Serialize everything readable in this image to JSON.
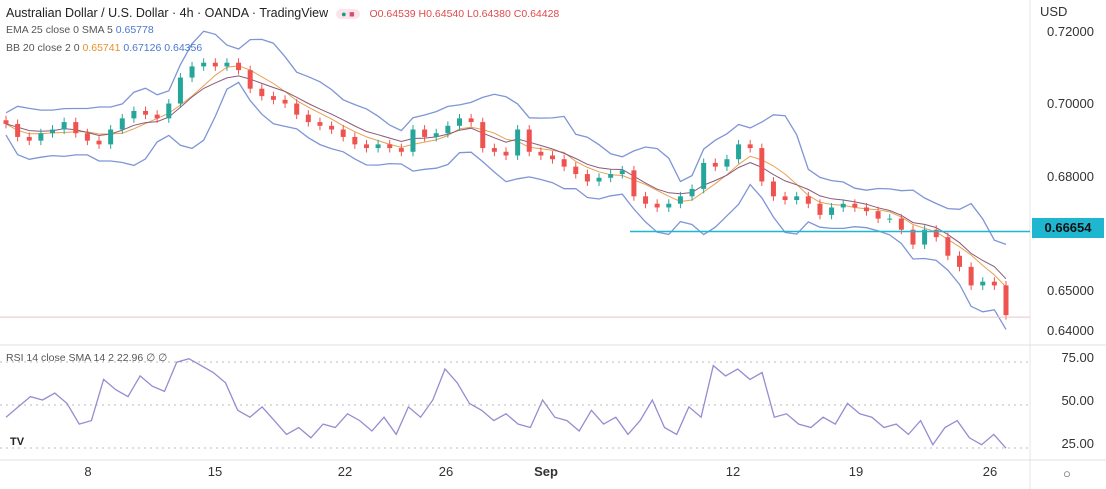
{
  "header": {
    "title": "Australian Dollar / U.S. Dollar · 4h · OANDA · TradingView",
    "open": "O0.64539",
    "high": "H0.64540",
    "low": "L0.64380",
    "close": "C0.64428",
    "ema_label": "EMA 25 close 0 SMA 5",
    "ema_value": "0.65778",
    "bb_label": "BB 20 close 2 0",
    "bb_basis": "0.65741",
    "bb_upper": "0.67126",
    "bb_lower": "0.64356",
    "rsi_label": "RSI 14 close SMA 14 2",
    "rsi_value": "22.96",
    "rsi_extra": "∅ ∅"
  },
  "axis": {
    "currency": "USD",
    "price_ticks": [
      "0.72000",
      "0.70000",
      "0.68000",
      "0.65000",
      "0.64000"
    ],
    "rsi_ticks": [
      "75.00",
      "50.00",
      "25.00"
    ],
    "time_ticks": [
      "8",
      "15",
      "22",
      "26",
      "Sep",
      "12",
      "19",
      "26"
    ]
  },
  "level": {
    "value": "0.66654",
    "color": "#1fb6d0"
  },
  "logo": "TV",
  "chart_data": {
    "type": "candlestick",
    "title": "Australian Dollar / U.S. Dollar 4h",
    "ylim": [
      0.64,
      0.72
    ],
    "closes": [
      0.6955,
      0.692,
      0.691,
      0.693,
      0.694,
      0.696,
      0.693,
      0.691,
      0.69,
      0.694,
      0.697,
      0.699,
      0.698,
      0.697,
      0.701,
      0.708,
      0.711,
      0.712,
      0.711,
      0.712,
      0.71,
      0.705,
      0.703,
      0.702,
      0.701,
      0.698,
      0.696,
      0.695,
      0.694,
      0.692,
      0.69,
      0.689,
      0.69,
      0.689,
      0.688,
      0.694,
      0.692,
      0.693,
      0.695,
      0.697,
      0.696,
      0.689,
      0.688,
      0.687,
      0.694,
      0.688,
      0.687,
      0.686,
      0.684,
      0.682,
      0.68,
      0.681,
      0.682,
      0.683,
      0.676,
      0.674,
      0.673,
      0.674,
      0.676,
      0.678,
      0.685,
      0.684,
      0.686,
      0.69,
      0.689,
      0.68,
      0.676,
      0.675,
      0.676,
      0.674,
      0.671,
      0.673,
      0.674,
      0.673,
      0.672,
      0.67,
      0.67,
      0.667,
      0.663,
      0.667,
      0.665,
      0.66,
      0.657,
      0.652,
      0.653,
      0.652,
      0.644
    ],
    "rsi": [
      40,
      46,
      52,
      50,
      54,
      48,
      36,
      38,
      62,
      56,
      52,
      64,
      58,
      55,
      72,
      74,
      70,
      66,
      60,
      44,
      40,
      46,
      38,
      30,
      34,
      28,
      36,
      34,
      42,
      38,
      32,
      40,
      30,
      46,
      40,
      50,
      68,
      60,
      48,
      44,
      38,
      42,
      36,
      34,
      50,
      40,
      38,
      32,
      44,
      36,
      40,
      30,
      38,
      50,
      34,
      30,
      46,
      40,
      70,
      64,
      68,
      62,
      66,
      40,
      42,
      36,
      34,
      40,
      36,
      48,
      42,
      40,
      34,
      36,
      30,
      38,
      24,
      34,
      38,
      28,
      24,
      30,
      22
    ],
    "rsi_ylim": [
      0,
      100
    ],
    "time_ticks": [
      "8",
      "15",
      "22",
      "26",
      "Sep",
      "12",
      "19",
      "26"
    ],
    "horizontal_level": 0.66654
  }
}
